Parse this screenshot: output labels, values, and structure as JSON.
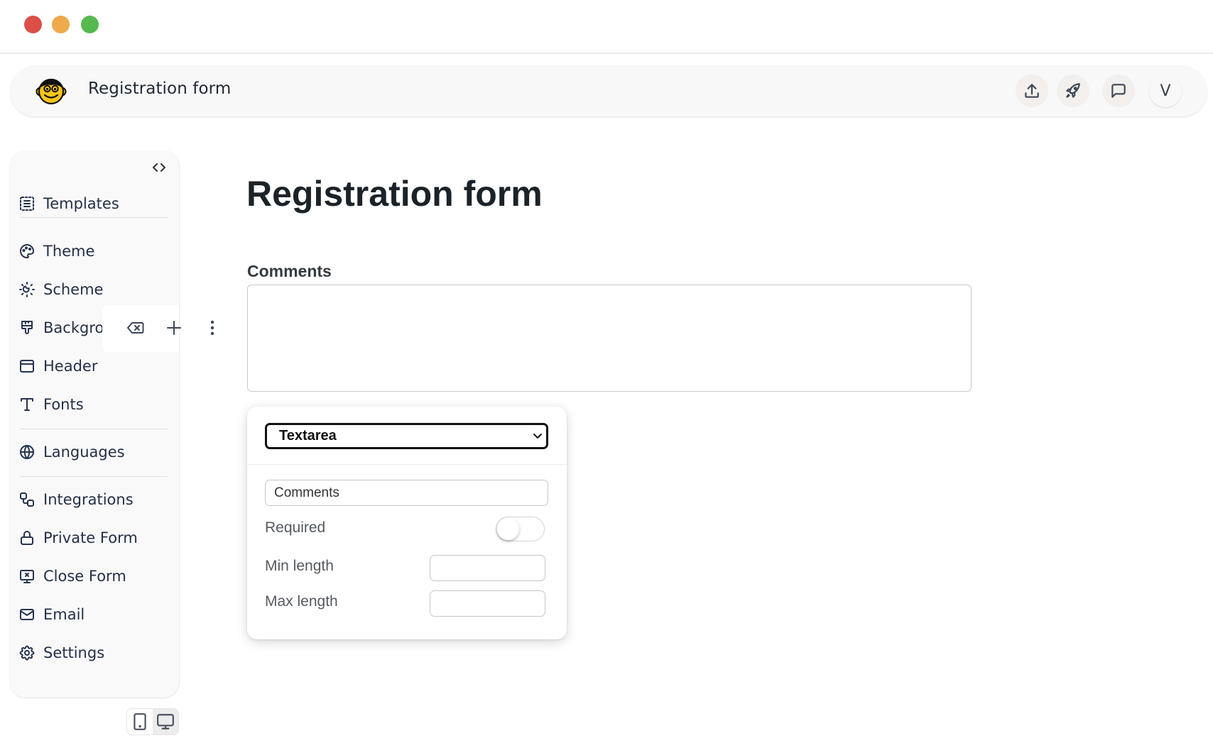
{
  "window": {
    "controls": [
      {
        "name": "close",
        "color": "#dc4f47"
      },
      {
        "name": "minimize",
        "color": "#eeaa4b"
      },
      {
        "name": "maximize",
        "color": "#55b94f"
      }
    ]
  },
  "header": {
    "logo_icon": "monkey-face-icon",
    "title": "Registration form",
    "actions": [
      {
        "name": "upload",
        "icon": "upload-icon"
      },
      {
        "name": "publish",
        "icon": "rocket-icon"
      },
      {
        "name": "comments",
        "icon": "chat-bubble-icon"
      }
    ],
    "avatar_initial": "V"
  },
  "sidebar": {
    "collapse_icon": "code-brackets-icon",
    "items": [
      {
        "label": "Templates",
        "icon": "template-list-icon"
      },
      {
        "label": "Theme",
        "icon": "palette-icon"
      },
      {
        "label": "Scheme",
        "icon": "sun-moon-icon"
      },
      {
        "label": "Background",
        "label_visible": "Backgro",
        "icon": "paint-brush-icon"
      },
      {
        "label": "Header",
        "icon": "layout-header-icon"
      },
      {
        "label": "Fonts",
        "icon": "typography-icon"
      },
      {
        "label": "Languages",
        "icon": "globe-icon"
      },
      {
        "label": "Integrations",
        "icon": "integrations-icon"
      },
      {
        "label": "Private Form",
        "icon": "lock-icon"
      },
      {
        "label": "Close Form",
        "icon": "close-form-icon"
      },
      {
        "label": "Email",
        "icon": "mail-icon"
      },
      {
        "label": "Settings",
        "icon": "gear-icon"
      }
    ]
  },
  "field_toolbar": {
    "actions": [
      {
        "name": "delete",
        "icon": "backspace-icon"
      },
      {
        "name": "add",
        "icon": "plus-icon"
      },
      {
        "name": "more",
        "icon": "more-vertical-icon"
      }
    ]
  },
  "device_toggle": {
    "options": [
      {
        "name": "mobile",
        "icon": "tablet-icon",
        "active": false
      },
      {
        "name": "desktop",
        "icon": "desktop-icon",
        "active": true
      }
    ]
  },
  "form": {
    "title": "Registration form",
    "fields": [
      {
        "label": "Comments",
        "type": "textarea",
        "value": ""
      }
    ]
  },
  "field_editor": {
    "type_select": {
      "selected": "Textarea"
    },
    "label_value": "Comments",
    "required": {
      "label": "Required",
      "on": false
    },
    "min_length": {
      "label": "Min length",
      "value": ""
    },
    "max_length": {
      "label": "Max length",
      "value": ""
    }
  }
}
